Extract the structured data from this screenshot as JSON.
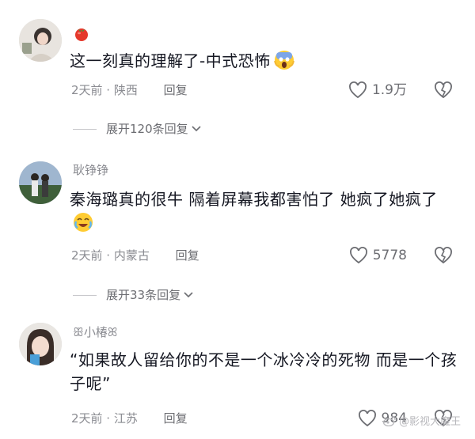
{
  "comments": [
    {
      "username": "",
      "username_icon": "tomato-icon",
      "text": "这一刻真的理解了-中式恐怖",
      "text_emoji": "screaming-face-emoji",
      "time_location": "2天前 · 陕西",
      "reply_label": "回复",
      "likes": "1.9万",
      "expand_label": "展开120条回复"
    },
    {
      "username": "耿铮铮",
      "text": "秦海璐真的很牛 隔着屏幕我都害怕了 她疯了她疯了",
      "text_emoji": "crying-laughing-emoji",
      "time_location": "2天前 · 内蒙古",
      "reply_label": "回复",
      "likes": "5778",
      "expand_label": "展开33条回复"
    },
    {
      "username": "ꕥ小椿ꕤ",
      "text": "“如果故人留给你的不是一个冰冷冷的死物 而是一个孩子呢”",
      "time_location": "2天前 · 江苏",
      "reply_label": "回复",
      "likes": "984"
    }
  ],
  "watermark": "@影视大魔王",
  "colors": {
    "text": "#161823",
    "meta": "#8a8b91",
    "action": "#6c6d72"
  }
}
